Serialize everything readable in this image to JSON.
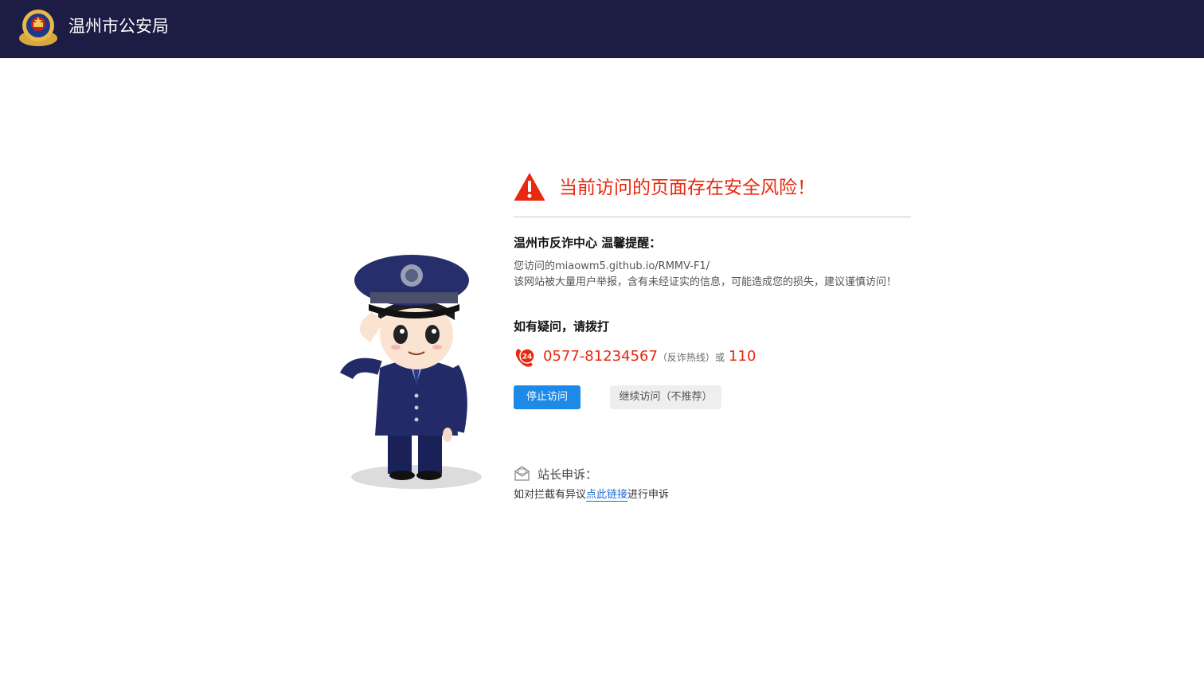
{
  "header": {
    "title": "温州市公安局",
    "emblem_icon": "police-emblem-icon"
  },
  "illustration": {
    "icon": "saluting-policeman-icon"
  },
  "warning": {
    "icon": "warning-triangle-icon",
    "title": "当前访问的页面存在安全风险！",
    "color": "#e8280f"
  },
  "reminder": {
    "title": "温州市反诈中心 温馨提醒：",
    "url_line": "您访问的miaowm5.github.io/RMMV-F1/",
    "body": "该网站被大量用户举报，含有未经证实的信息，可能造成您的损失，建议谨慎访问！"
  },
  "contact": {
    "ask": "如有疑问，请拨打",
    "icon": "phone-24-icon",
    "hotline": "0577-81234567",
    "hotline_note": "（反诈热线）",
    "or": "或",
    "emergency": "110"
  },
  "actions": {
    "stop_label": "停止访问",
    "continue_label": "继续访问（不推荐）",
    "primary_color": "#1e8ae8"
  },
  "appeal": {
    "icon": "mail-icon",
    "title": "站长申诉：",
    "prefix": "如对拦截有异议",
    "link_label": "点此链接",
    "suffix": "进行申诉"
  }
}
